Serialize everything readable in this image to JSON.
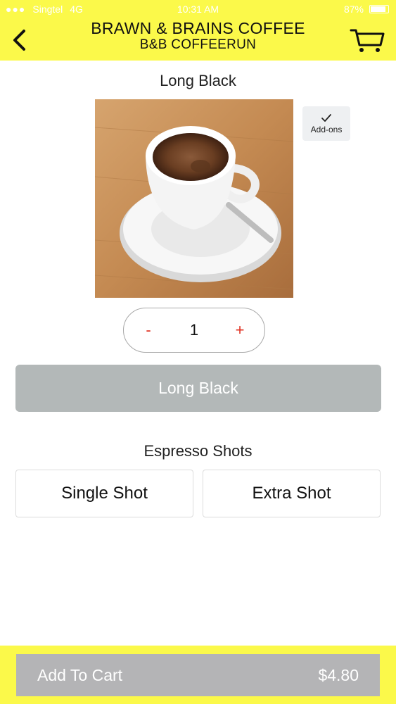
{
  "status_bar": {
    "carrier": "Singtel",
    "network": "4G",
    "time": "10:31 AM",
    "battery": "87%"
  },
  "header": {
    "title": "BRAWN & BRAINS COFFEE",
    "subtitle": "B&B COFFEERUN",
    "back_icon": "chevron-left-icon",
    "cart_icon": "shopping-cart-icon",
    "background_color": "#fbf94a"
  },
  "product": {
    "name": "Long Black",
    "image": "coffee-cup-photo",
    "addons_label": "Add-ons",
    "addons_icon": "checkmark-icon"
  },
  "quantity": {
    "minus_label": "-",
    "value": "1",
    "plus_label": "+"
  },
  "variant": {
    "selected_label": "Long Black"
  },
  "espresso_shots": {
    "heading": "Espresso Shots",
    "options": [
      {
        "label": "Single Shot"
      },
      {
        "label": "Extra Shot"
      }
    ]
  },
  "footer": {
    "add_to_cart_label": "Add To Cart",
    "price": "$4.80",
    "background_color": "#fbf94a"
  }
}
